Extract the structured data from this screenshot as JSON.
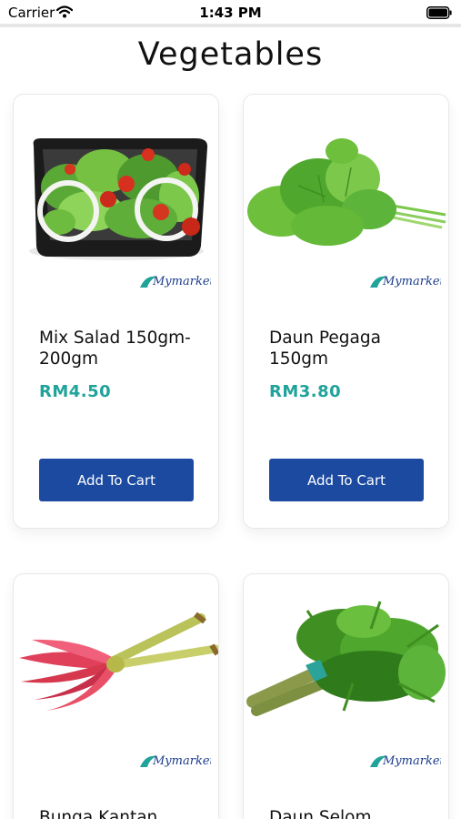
{
  "status_bar": {
    "carrier": "Carrier",
    "time": "1:43 PM"
  },
  "header": {
    "title": "Vegetables"
  },
  "colors": {
    "accent_price": "#1fa39a",
    "button": "#1b4aa0"
  },
  "products": [
    {
      "name": "Mix Salad 150gm-200gm",
      "price": "RM4.50",
      "button_label": "Add To Cart",
      "brand": "Mymarket"
    },
    {
      "name": "Daun Pegaga 150gm",
      "price": "RM3.80",
      "button_label": "Add To Cart",
      "brand": "Mymarket"
    },
    {
      "name": "Bunga Kantan",
      "brand": "Mymarket"
    },
    {
      "name": "Daun Selom",
      "brand": "Mymarket"
    }
  ]
}
